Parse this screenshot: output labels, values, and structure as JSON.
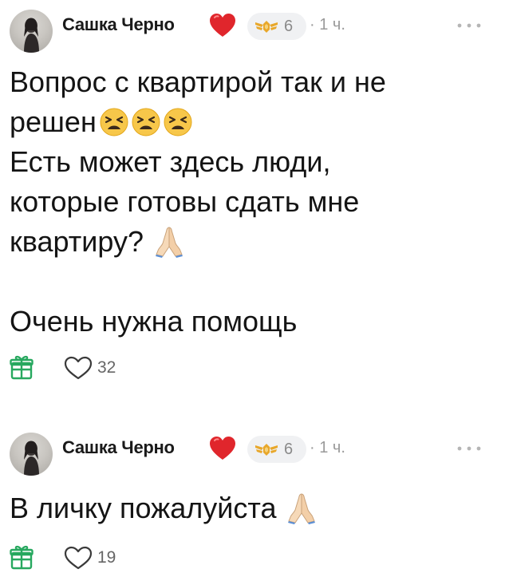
{
  "posts": [
    {
      "author": "Сашка Черно",
      "badge_level": "6",
      "time": "· 1 ч.",
      "lines": [
        "Вопрос с квартирой так и не",
        "решен",
        "Есть может здесь люди,",
        "которые готовы сдать мне",
        "квартиру?",
        "",
        "Очень нужна помощь"
      ],
      "likes": "32"
    },
    {
      "author": "Сашка Черно",
      "badge_level": "6",
      "time": "· 1 ч.",
      "lines": [
        "В личку пожалуйста"
      ],
      "likes": "19"
    }
  ],
  "icons": {
    "heart": "heart-icon",
    "badge": "badge-wings-icon",
    "more": "more-dots-icon",
    "gift": "gift-icon",
    "like": "heart-outline-icon",
    "tired_emoji": "tired-face-emoji",
    "pray_emoji": "folded-hands-emoji"
  },
  "colors": {
    "heart": "#e0262c",
    "badge_gold": "#e8a72a",
    "gift_green": "#27a85f",
    "text": "#141414",
    "muted": "#9a9a9a"
  }
}
